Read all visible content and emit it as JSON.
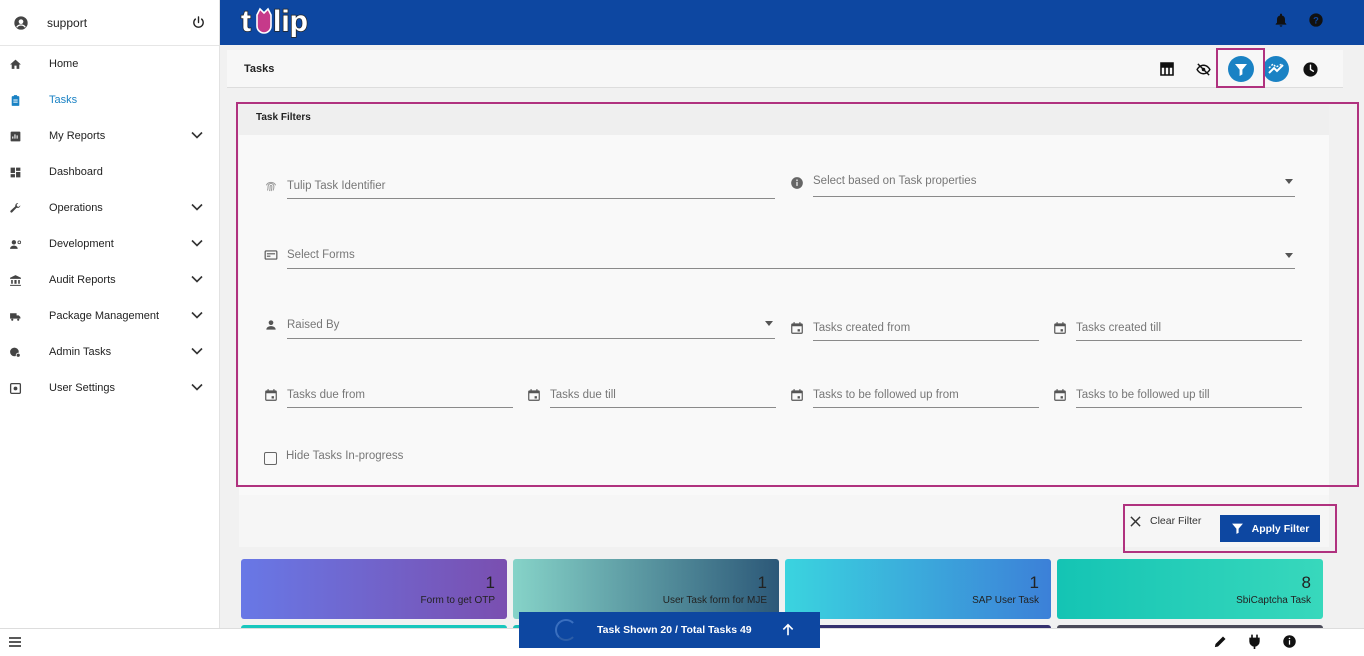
{
  "sidebar": {
    "user": "support",
    "items": [
      {
        "label": "Home",
        "icon": "home-icon",
        "chevron": false,
        "active": false
      },
      {
        "label": "Tasks",
        "icon": "clipboard-icon",
        "chevron": false,
        "active": true
      },
      {
        "label": "My Reports",
        "icon": "report-icon",
        "chevron": true,
        "active": false
      },
      {
        "label": "Dashboard",
        "icon": "dashboard-icon",
        "chevron": false,
        "active": false
      },
      {
        "label": "Operations",
        "icon": "wrench-icon",
        "chevron": true,
        "active": false
      },
      {
        "label": "Development",
        "icon": "developer-icon",
        "chevron": true,
        "active": false
      },
      {
        "label": "Audit Reports",
        "icon": "bank-icon",
        "chevron": true,
        "active": false
      },
      {
        "label": "Package Management",
        "icon": "truck-icon",
        "chevron": true,
        "active": false
      },
      {
        "label": "Admin Tasks",
        "icon": "admin-icon",
        "chevron": true,
        "active": false
      },
      {
        "label": "User Settings",
        "icon": "settings-icon",
        "chevron": true,
        "active": false
      }
    ]
  },
  "header": {
    "brand": "tulip"
  },
  "tasks_header": {
    "title": "Tasks"
  },
  "filters": {
    "title": "Task Filters",
    "identifier": "Tulip Task Identifier",
    "properties": "Select based on Task properties",
    "forms": "Select Forms",
    "raised_by": "Raised By",
    "created_from": "Tasks created from",
    "created_till": "Tasks created till",
    "due_from": "Tasks due from",
    "due_till": "Tasks due till",
    "followup_from": "Tasks to be followed up from",
    "followup_till": "Tasks to be followed up till",
    "hide_in_progress": "Hide Tasks In-progress",
    "clear_label": "Clear Filter",
    "apply_label": "Apply Filter"
  },
  "cards": [
    {
      "count": "1",
      "label": "Form to get OTP",
      "gradient": [
        "#6878e6",
        "#7a4fb0"
      ]
    },
    {
      "count": "1",
      "label": "User Task form for MJE",
      "gradient": [
        "#86d3c8",
        "#2c5878"
      ]
    },
    {
      "count": "1",
      "label": "SAP User Task",
      "gradient": [
        "#3ad4df",
        "#3c80d8"
      ]
    },
    {
      "count": "8",
      "label": "SbiCaptcha Task",
      "gradient": [
        "#14c4b4",
        "#38d8bc"
      ]
    }
  ],
  "status": {
    "text": "Task Shown 20 / Total Tasks 49"
  },
  "colors": {
    "primary": "#0d47a1",
    "highlight": "#b0327f",
    "active": "#1a82c4"
  }
}
